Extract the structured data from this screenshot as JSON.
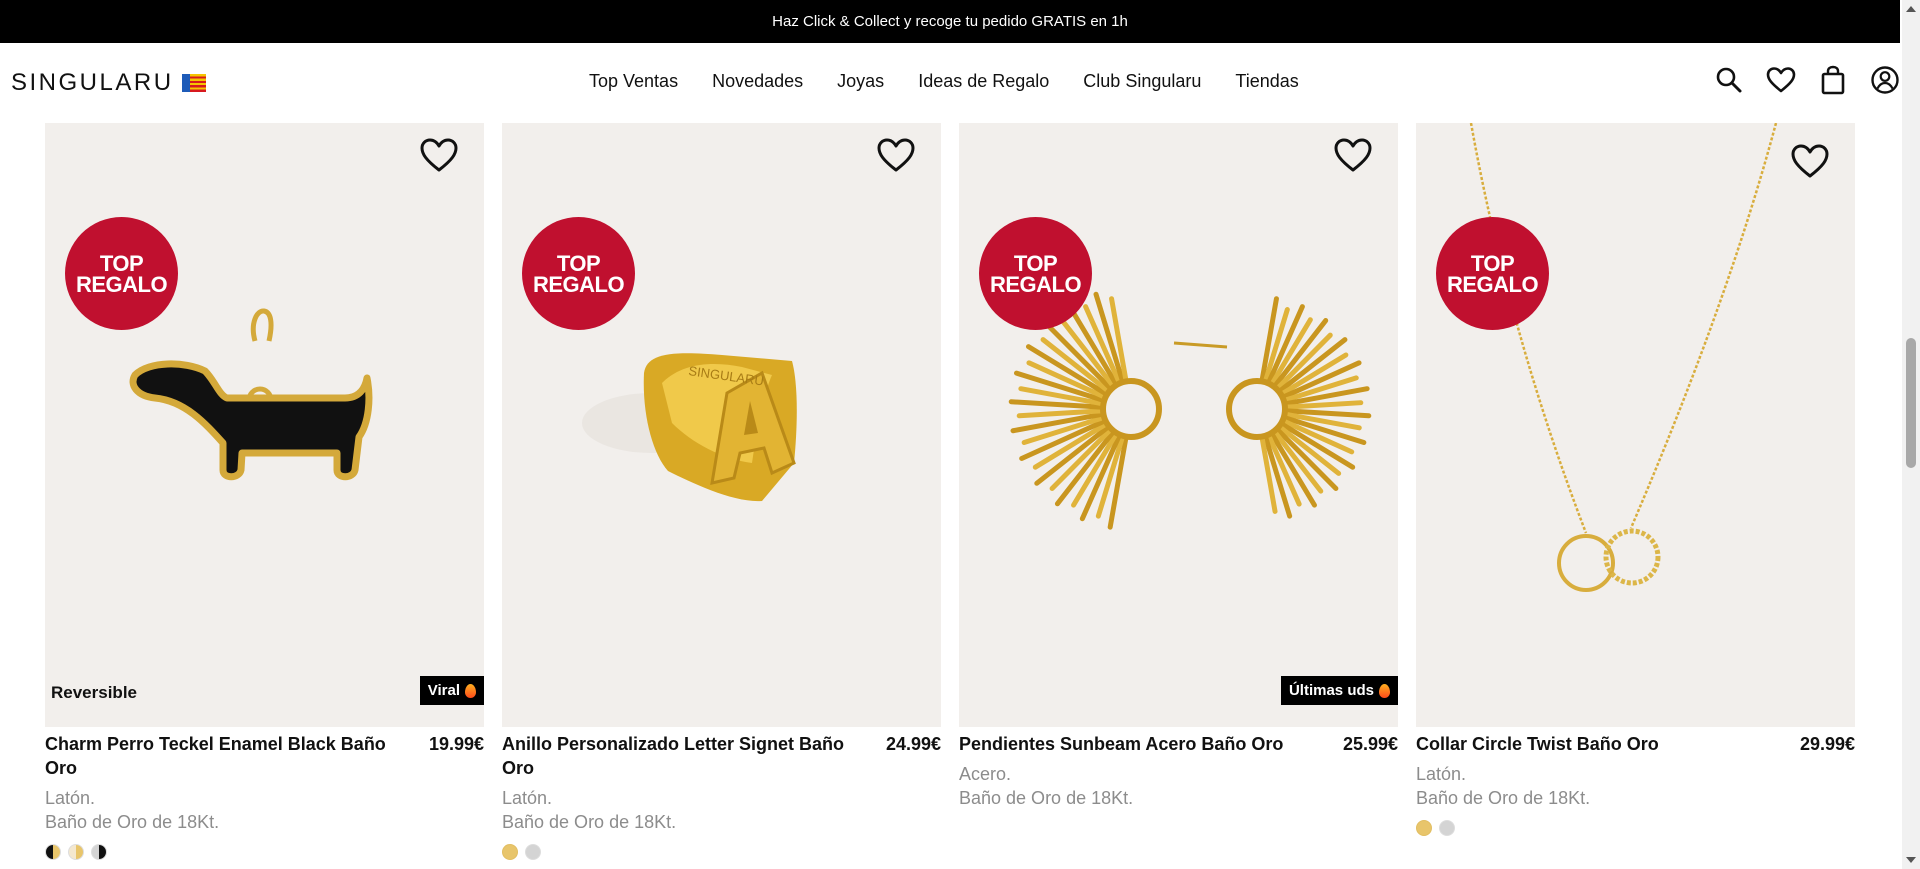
{
  "promo": {
    "text": "Haz Click & Collect y recoge tu pedido GRATIS en 1h"
  },
  "header": {
    "logo": "SINGULARU",
    "nav": [
      "Top Ventas",
      "Novedades",
      "Joyas",
      "Ideas de Regalo",
      "Club Singularu",
      "Tiendas"
    ],
    "icons": [
      "search-icon",
      "heart-icon",
      "bag-icon",
      "user-icon"
    ]
  },
  "badge": {
    "line1": "TOP",
    "line2": "REGALO"
  },
  "products": [
    {
      "title": "Charm Perro Teckel Enamel Black Baño Oro",
      "price": "19.99€",
      "material": "Latón.",
      "finish": "Baño de Oro de 18Kt.",
      "tag": "Viral",
      "left_tag": "Reversible",
      "swatches": [
        "gold-black",
        "gold-cream",
        "silver-black"
      ]
    },
    {
      "title": "Anillo Personalizado Letter Signet Baño Oro",
      "price": "24.99€",
      "material": "Latón.",
      "finish": "Baño de Oro de 18Kt.",
      "swatches": [
        "gold",
        "silver"
      ]
    },
    {
      "title": "Pendientes Sunbeam Acero Baño Oro",
      "price": "25.99€",
      "material": "Acero.",
      "finish": "Baño de Oro de 18Kt.",
      "tag": "Últimas uds",
      "swatches": []
    },
    {
      "title": "Collar Circle Twist Baño Oro",
      "price": "29.99€",
      "material": "Latón.",
      "finish": "Baño de Oro de 18Kt.",
      "swatches": [
        "gold",
        "silver"
      ]
    }
  ],
  "colors": {
    "badge": "#c0102f",
    "promo_bg": "#000000",
    "card_bg": "#f2efec",
    "gold": "#e8c56b"
  }
}
